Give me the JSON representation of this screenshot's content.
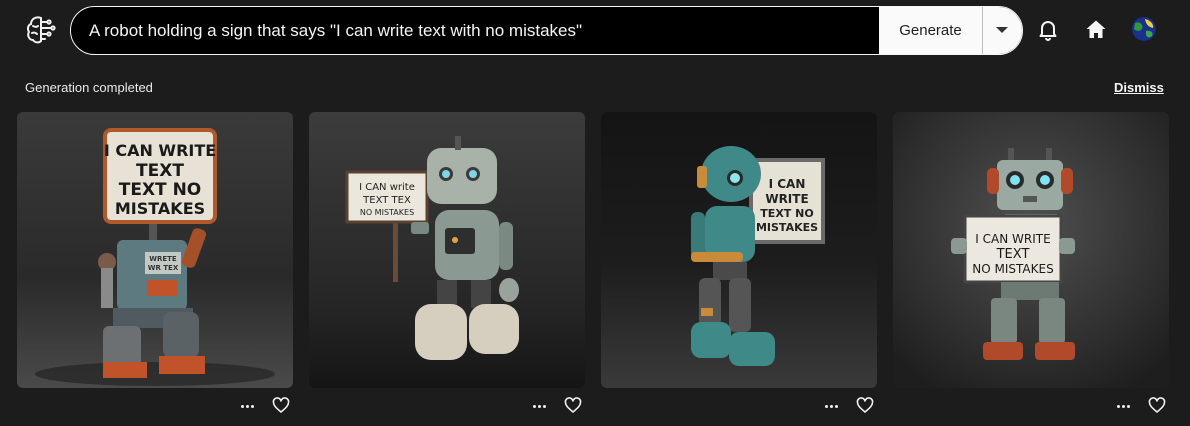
{
  "prompt": {
    "value": "A robot holding a sign that says \"I can write text with no mistakes\"",
    "generate_label": "Generate"
  },
  "header": {
    "logo_icon": "brain-circuit-icon",
    "notifications_icon": "bell-icon",
    "home_icon": "home-icon",
    "avatar_icon": "globe-avatar-icon"
  },
  "status": {
    "message": "Generation completed",
    "dismiss_label": "Dismiss"
  },
  "images": [
    {
      "sign_lines": [
        "I CAN WRITE",
        "TEXT",
        "TEXT NO",
        "MISTAKES"
      ],
      "chest_lines": [
        "WRETE",
        "WR TEX"
      ],
      "robot_color": "#5d7a80",
      "accent": "#c0532a"
    },
    {
      "sign_lines": [
        "I CAN write",
        "TEXT TEX",
        "NO MISTAKES"
      ],
      "robot_color": "#8a9a92",
      "accent": "#9a7a5a"
    },
    {
      "sign_lines": [
        "I CAN",
        "WRITE",
        "TEXT NO",
        "MISTAKES"
      ],
      "robot_color": "#3f8a88",
      "accent": "#c98a3a"
    },
    {
      "sign_lines": [
        "I CAN WRITE",
        "TEXT",
        "NO MISTAKES"
      ],
      "robot_color": "#8a9c94",
      "accent": "#b04a2a"
    }
  ]
}
